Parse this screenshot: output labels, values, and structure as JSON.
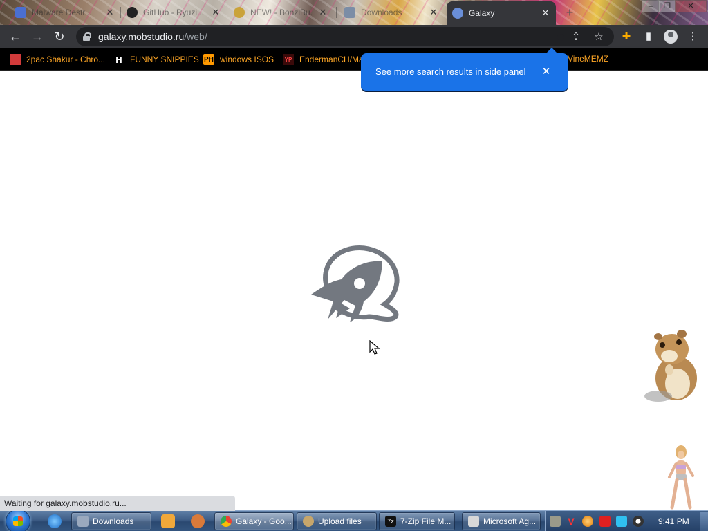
{
  "browser": {
    "tabs": [
      {
        "label": "Malware Destr...",
        "favicon_color": "#4a6fd1",
        "active": false
      },
      {
        "label": "GitHub - Ryuzi...",
        "favicon_color": "#222222",
        "active": false
      },
      {
        "label": "NEW! - BonziBu...",
        "favicon_color": "#caa33a",
        "active": false
      },
      {
        "label": "Downloads",
        "favicon_color": "#7b8da6",
        "active": false
      },
      {
        "label": "Galaxy",
        "favicon_color": "#6a8fd8",
        "active": true
      }
    ],
    "url": {
      "host": "galaxy.mobstudio.ru",
      "path": "/web/"
    },
    "bookmarks": [
      {
        "label": "2pac Shakur - Chro...",
        "icon_text": "",
        "icon_color": "#d23b3b"
      },
      {
        "label": "FUNNY SNIPPIES",
        "icon_text": "H",
        "icon_color": "#ffffff"
      },
      {
        "label": "windows ISOS",
        "icon_text": "PH",
        "icon_color": "#ff9900"
      },
      {
        "label": "EndermanCH/Ma",
        "icon_text": "YP",
        "icon_color": "#cc0000"
      },
      {
        "label": "VineMEMZ",
        "icon_text": "",
        "icon_color": "#000000"
      }
    ],
    "promo": {
      "text": "See more search results in side panel"
    },
    "status": "Waiting for galaxy.mobstudio.ru..."
  },
  "taskbar": {
    "buttons": [
      {
        "label": "Downloads",
        "icon_color": "#9aa9be",
        "active": false
      },
      {
        "label": "Galaxy - Goo...",
        "icon_color": "#e2443b",
        "active": true
      },
      {
        "label": "Upload files",
        "icon_color": "#c7a66b",
        "active": false
      },
      {
        "label": "7-Zip File M...",
        "icon_color": "#111111",
        "active": false
      },
      {
        "label": "Microsoft Ag...",
        "icon_color": "#d8d8d8",
        "active": false
      }
    ],
    "clock": "9:41 PM"
  },
  "colors": {
    "accent": "#1a73e8",
    "toolbar": "#35363a",
    "bookmark_text": "#ffa726",
    "logo_gray": "#737880"
  }
}
